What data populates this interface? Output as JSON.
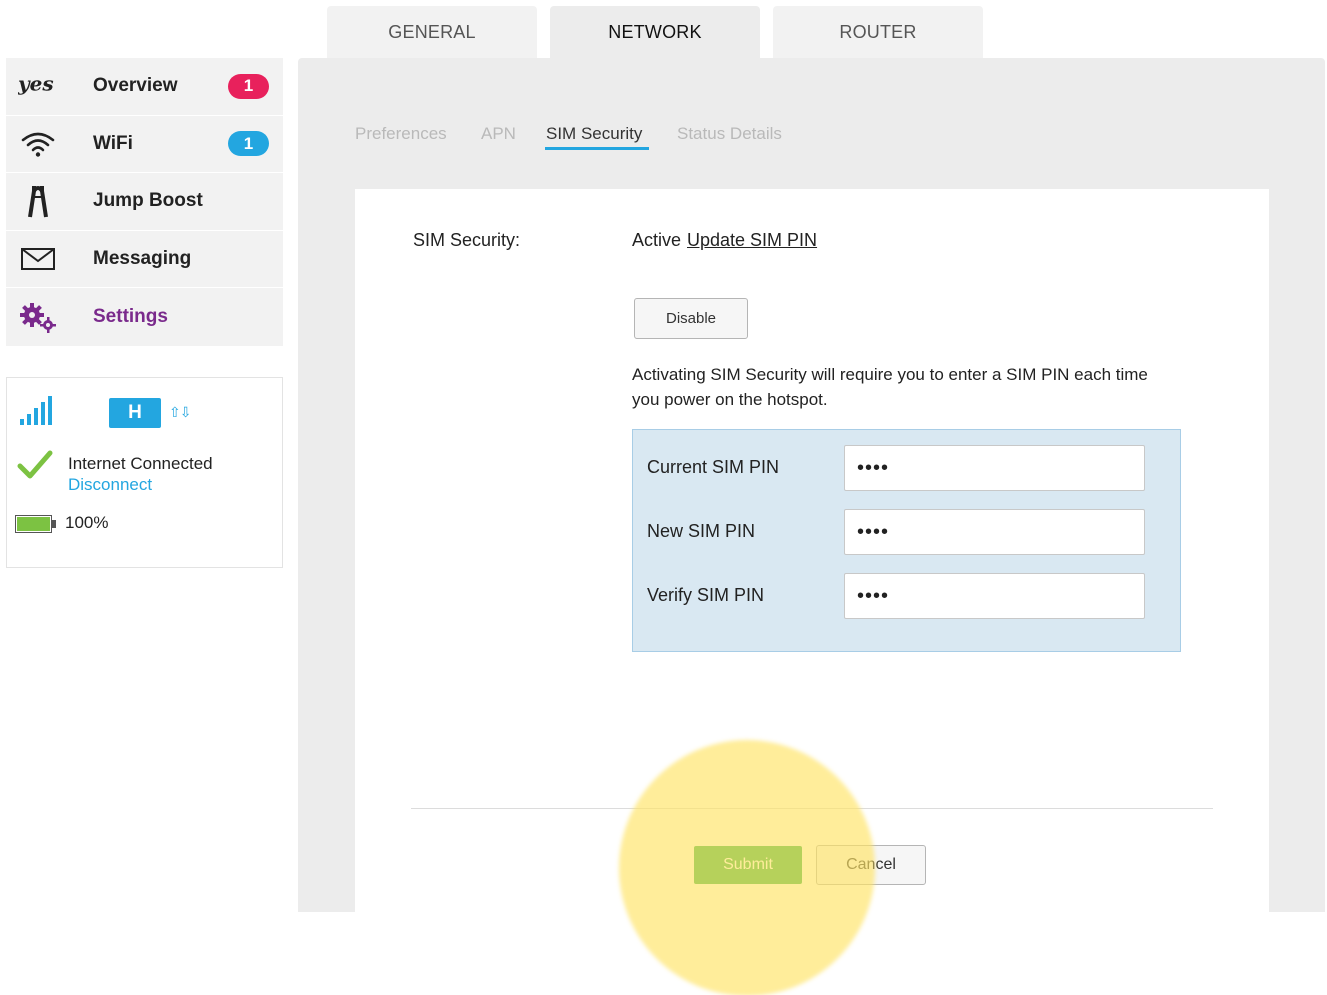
{
  "colors": {
    "accent_blue": "#23a6e0",
    "brand_purple": "#7a2a8c",
    "badge_pink": "#e8215c",
    "submit_green": "#2fae4b",
    "highlight_yellow": "#ffe464"
  },
  "top_tabs": [
    {
      "label": "GENERAL",
      "active": false
    },
    {
      "label": "NETWORK",
      "active": true
    },
    {
      "label": "ROUTER",
      "active": false
    }
  ],
  "sidebar": {
    "items": [
      {
        "label": "Overview",
        "icon": "yes-logo-icon",
        "badge": "1",
        "badge_color": "#e8215c",
        "active": false
      },
      {
        "label": "WiFi",
        "icon": "wifi-icon",
        "badge": "1",
        "badge_color": "#23a6e0",
        "active": false
      },
      {
        "label": "Jump Boost",
        "icon": "jump-boost-icon",
        "badge": "",
        "active": false
      },
      {
        "label": "Messaging",
        "icon": "envelope-icon",
        "badge": "",
        "active": false
      },
      {
        "label": "Settings",
        "icon": "gears-icon",
        "badge": "",
        "active": true
      }
    ]
  },
  "status": {
    "network_type": "H",
    "signal_icon": "signal-bars-icon",
    "transfer_icon": "up-down-arrows-icon",
    "arrows": "⇧⇩",
    "connection_text": "Internet Connected",
    "disconnect_label": "Disconnect",
    "battery_icon": "battery-icon",
    "battery_level": 100,
    "battery_text": "100%"
  },
  "sub_tabs": [
    {
      "label": "Preferences",
      "active": false
    },
    {
      "label": "APN",
      "active": false
    },
    {
      "label": "SIM Security",
      "active": true
    },
    {
      "label": "Status Details",
      "active": false
    }
  ],
  "sim_security": {
    "label": "SIM Security:",
    "status": "Active",
    "update_link": "Update SIM PIN",
    "disable_label": "Disable",
    "description": "Activating SIM Security will require you to enter a SIM PIN each time you power on the hotspot.",
    "fields": [
      {
        "label": "Current SIM PIN",
        "value": "••••"
      },
      {
        "label": "New SIM PIN",
        "value": "••••"
      },
      {
        "label": "Verify SIM PIN",
        "value": "••••"
      }
    ],
    "submit_label": "Submit",
    "cancel_label": "Cancel"
  }
}
